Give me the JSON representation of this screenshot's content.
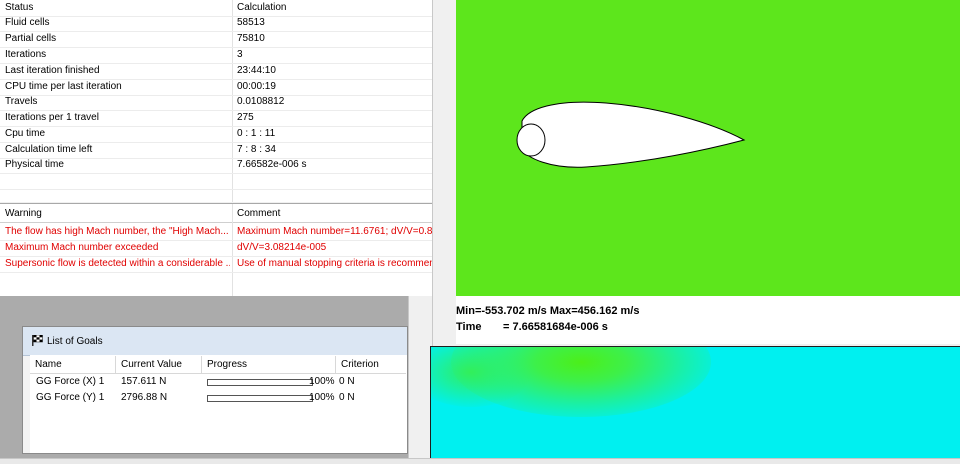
{
  "info_table": {
    "header": {
      "name": "Status",
      "value": "Calculation"
    },
    "rows": [
      {
        "name": "Fluid cells",
        "value": "58513"
      },
      {
        "name": "Partial cells",
        "value": "75810"
      },
      {
        "name": "Iterations",
        "value": "3"
      },
      {
        "name": "Last iteration finished",
        "value": "23:44:10"
      },
      {
        "name": "CPU time per last iteration",
        "value": "00:00:19"
      },
      {
        "name": "Travels",
        "value": "0.0108812"
      },
      {
        "name": "Iterations per 1 travel",
        "value": "275"
      },
      {
        "name": "Cpu time",
        "value": "0 : 1 : 11"
      },
      {
        "name": "Calculation time left",
        "value": "7 : 8 : 34"
      },
      {
        "name": "Physical time",
        "value": "7.66582e-006 s"
      }
    ]
  },
  "warnings": {
    "header": {
      "warning": "Warning",
      "comment": "Comment"
    },
    "rows": [
      {
        "warning": "The flow has high Mach number, the \"High Mach...",
        "comment": "Maximum Mach number=11.6761; dV/V=0.8"
      },
      {
        "warning": "Maximum Mach number exceeded",
        "comment": "dV/V=3.08214e-005"
      },
      {
        "warning": "Supersonic flow is detected within a considerable ...",
        "comment": "Use of manual stopping criteria is recommen"
      }
    ]
  },
  "goals": {
    "title": "List of Goals",
    "columns": [
      "Name",
      "Current Value",
      "Progress",
      "Criterion"
    ],
    "rows": [
      {
        "name": "GG Force (X) 1",
        "current_value": "157.611 N",
        "progress_text": "100%",
        "progress": 1.0,
        "criterion": "0 N"
      },
      {
        "name": "GG Force (Y) 1",
        "current_value": "2796.88 N",
        "progress_text": "100%",
        "progress": 1.0,
        "criterion": "0 N"
      }
    ]
  },
  "plot": {
    "minmax": "Min=-553.702 m/s   Max=456.162 m/s",
    "time_label": "Time",
    "time_value": "= 7.66581684e-006 s",
    "colors": {
      "flow_main": "#5de61c",
      "bottom_field": "#00f0f0"
    }
  }
}
